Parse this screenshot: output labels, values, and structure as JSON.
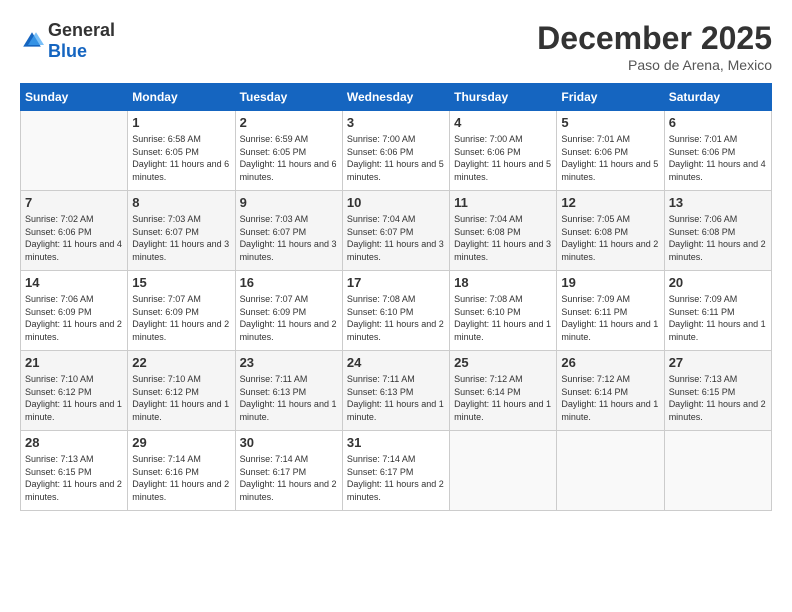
{
  "header": {
    "logo_general": "General",
    "logo_blue": "Blue",
    "month_title": "December 2025",
    "location": "Paso de Arena, Mexico"
  },
  "days_of_week": [
    "Sunday",
    "Monday",
    "Tuesday",
    "Wednesday",
    "Thursday",
    "Friday",
    "Saturday"
  ],
  "weeks": [
    [
      {
        "day": "",
        "sunrise": "",
        "sunset": "",
        "daylight": ""
      },
      {
        "day": "1",
        "sunrise": "Sunrise: 6:58 AM",
        "sunset": "Sunset: 6:05 PM",
        "daylight": "Daylight: 11 hours and 6 minutes."
      },
      {
        "day": "2",
        "sunrise": "Sunrise: 6:59 AM",
        "sunset": "Sunset: 6:05 PM",
        "daylight": "Daylight: 11 hours and 6 minutes."
      },
      {
        "day": "3",
        "sunrise": "Sunrise: 7:00 AM",
        "sunset": "Sunset: 6:06 PM",
        "daylight": "Daylight: 11 hours and 5 minutes."
      },
      {
        "day": "4",
        "sunrise": "Sunrise: 7:00 AM",
        "sunset": "Sunset: 6:06 PM",
        "daylight": "Daylight: 11 hours and 5 minutes."
      },
      {
        "day": "5",
        "sunrise": "Sunrise: 7:01 AM",
        "sunset": "Sunset: 6:06 PM",
        "daylight": "Daylight: 11 hours and 5 minutes."
      },
      {
        "day": "6",
        "sunrise": "Sunrise: 7:01 AM",
        "sunset": "Sunset: 6:06 PM",
        "daylight": "Daylight: 11 hours and 4 minutes."
      }
    ],
    [
      {
        "day": "7",
        "sunrise": "Sunrise: 7:02 AM",
        "sunset": "Sunset: 6:06 PM",
        "daylight": "Daylight: 11 hours and 4 minutes."
      },
      {
        "day": "8",
        "sunrise": "Sunrise: 7:03 AM",
        "sunset": "Sunset: 6:07 PM",
        "daylight": "Daylight: 11 hours and 3 minutes."
      },
      {
        "day": "9",
        "sunrise": "Sunrise: 7:03 AM",
        "sunset": "Sunset: 6:07 PM",
        "daylight": "Daylight: 11 hours and 3 minutes."
      },
      {
        "day": "10",
        "sunrise": "Sunrise: 7:04 AM",
        "sunset": "Sunset: 6:07 PM",
        "daylight": "Daylight: 11 hours and 3 minutes."
      },
      {
        "day": "11",
        "sunrise": "Sunrise: 7:04 AM",
        "sunset": "Sunset: 6:08 PM",
        "daylight": "Daylight: 11 hours and 3 minutes."
      },
      {
        "day": "12",
        "sunrise": "Sunrise: 7:05 AM",
        "sunset": "Sunset: 6:08 PM",
        "daylight": "Daylight: 11 hours and 2 minutes."
      },
      {
        "day": "13",
        "sunrise": "Sunrise: 7:06 AM",
        "sunset": "Sunset: 6:08 PM",
        "daylight": "Daylight: 11 hours and 2 minutes."
      }
    ],
    [
      {
        "day": "14",
        "sunrise": "Sunrise: 7:06 AM",
        "sunset": "Sunset: 6:09 PM",
        "daylight": "Daylight: 11 hours and 2 minutes."
      },
      {
        "day": "15",
        "sunrise": "Sunrise: 7:07 AM",
        "sunset": "Sunset: 6:09 PM",
        "daylight": "Daylight: 11 hours and 2 minutes."
      },
      {
        "day": "16",
        "sunrise": "Sunrise: 7:07 AM",
        "sunset": "Sunset: 6:09 PM",
        "daylight": "Daylight: 11 hours and 2 minutes."
      },
      {
        "day": "17",
        "sunrise": "Sunrise: 7:08 AM",
        "sunset": "Sunset: 6:10 PM",
        "daylight": "Daylight: 11 hours and 2 minutes."
      },
      {
        "day": "18",
        "sunrise": "Sunrise: 7:08 AM",
        "sunset": "Sunset: 6:10 PM",
        "daylight": "Daylight: 11 hours and 1 minute."
      },
      {
        "day": "19",
        "sunrise": "Sunrise: 7:09 AM",
        "sunset": "Sunset: 6:11 PM",
        "daylight": "Daylight: 11 hours and 1 minute."
      },
      {
        "day": "20",
        "sunrise": "Sunrise: 7:09 AM",
        "sunset": "Sunset: 6:11 PM",
        "daylight": "Daylight: 11 hours and 1 minute."
      }
    ],
    [
      {
        "day": "21",
        "sunrise": "Sunrise: 7:10 AM",
        "sunset": "Sunset: 6:12 PM",
        "daylight": "Daylight: 11 hours and 1 minute."
      },
      {
        "day": "22",
        "sunrise": "Sunrise: 7:10 AM",
        "sunset": "Sunset: 6:12 PM",
        "daylight": "Daylight: 11 hours and 1 minute."
      },
      {
        "day": "23",
        "sunrise": "Sunrise: 7:11 AM",
        "sunset": "Sunset: 6:13 PM",
        "daylight": "Daylight: 11 hours and 1 minute."
      },
      {
        "day": "24",
        "sunrise": "Sunrise: 7:11 AM",
        "sunset": "Sunset: 6:13 PM",
        "daylight": "Daylight: 11 hours and 1 minute."
      },
      {
        "day": "25",
        "sunrise": "Sunrise: 7:12 AM",
        "sunset": "Sunset: 6:14 PM",
        "daylight": "Daylight: 11 hours and 1 minute."
      },
      {
        "day": "26",
        "sunrise": "Sunrise: 7:12 AM",
        "sunset": "Sunset: 6:14 PM",
        "daylight": "Daylight: 11 hours and 1 minute."
      },
      {
        "day": "27",
        "sunrise": "Sunrise: 7:13 AM",
        "sunset": "Sunset: 6:15 PM",
        "daylight": "Daylight: 11 hours and 2 minutes."
      }
    ],
    [
      {
        "day": "28",
        "sunrise": "Sunrise: 7:13 AM",
        "sunset": "Sunset: 6:15 PM",
        "daylight": "Daylight: 11 hours and 2 minutes."
      },
      {
        "day": "29",
        "sunrise": "Sunrise: 7:14 AM",
        "sunset": "Sunset: 6:16 PM",
        "daylight": "Daylight: 11 hours and 2 minutes."
      },
      {
        "day": "30",
        "sunrise": "Sunrise: 7:14 AM",
        "sunset": "Sunset: 6:17 PM",
        "daylight": "Daylight: 11 hours and 2 minutes."
      },
      {
        "day": "31",
        "sunrise": "Sunrise: 7:14 AM",
        "sunset": "Sunset: 6:17 PM",
        "daylight": "Daylight: 11 hours and 2 minutes."
      },
      {
        "day": "",
        "sunrise": "",
        "sunset": "",
        "daylight": ""
      },
      {
        "day": "",
        "sunrise": "",
        "sunset": "",
        "daylight": ""
      },
      {
        "day": "",
        "sunrise": "",
        "sunset": "",
        "daylight": ""
      }
    ]
  ]
}
